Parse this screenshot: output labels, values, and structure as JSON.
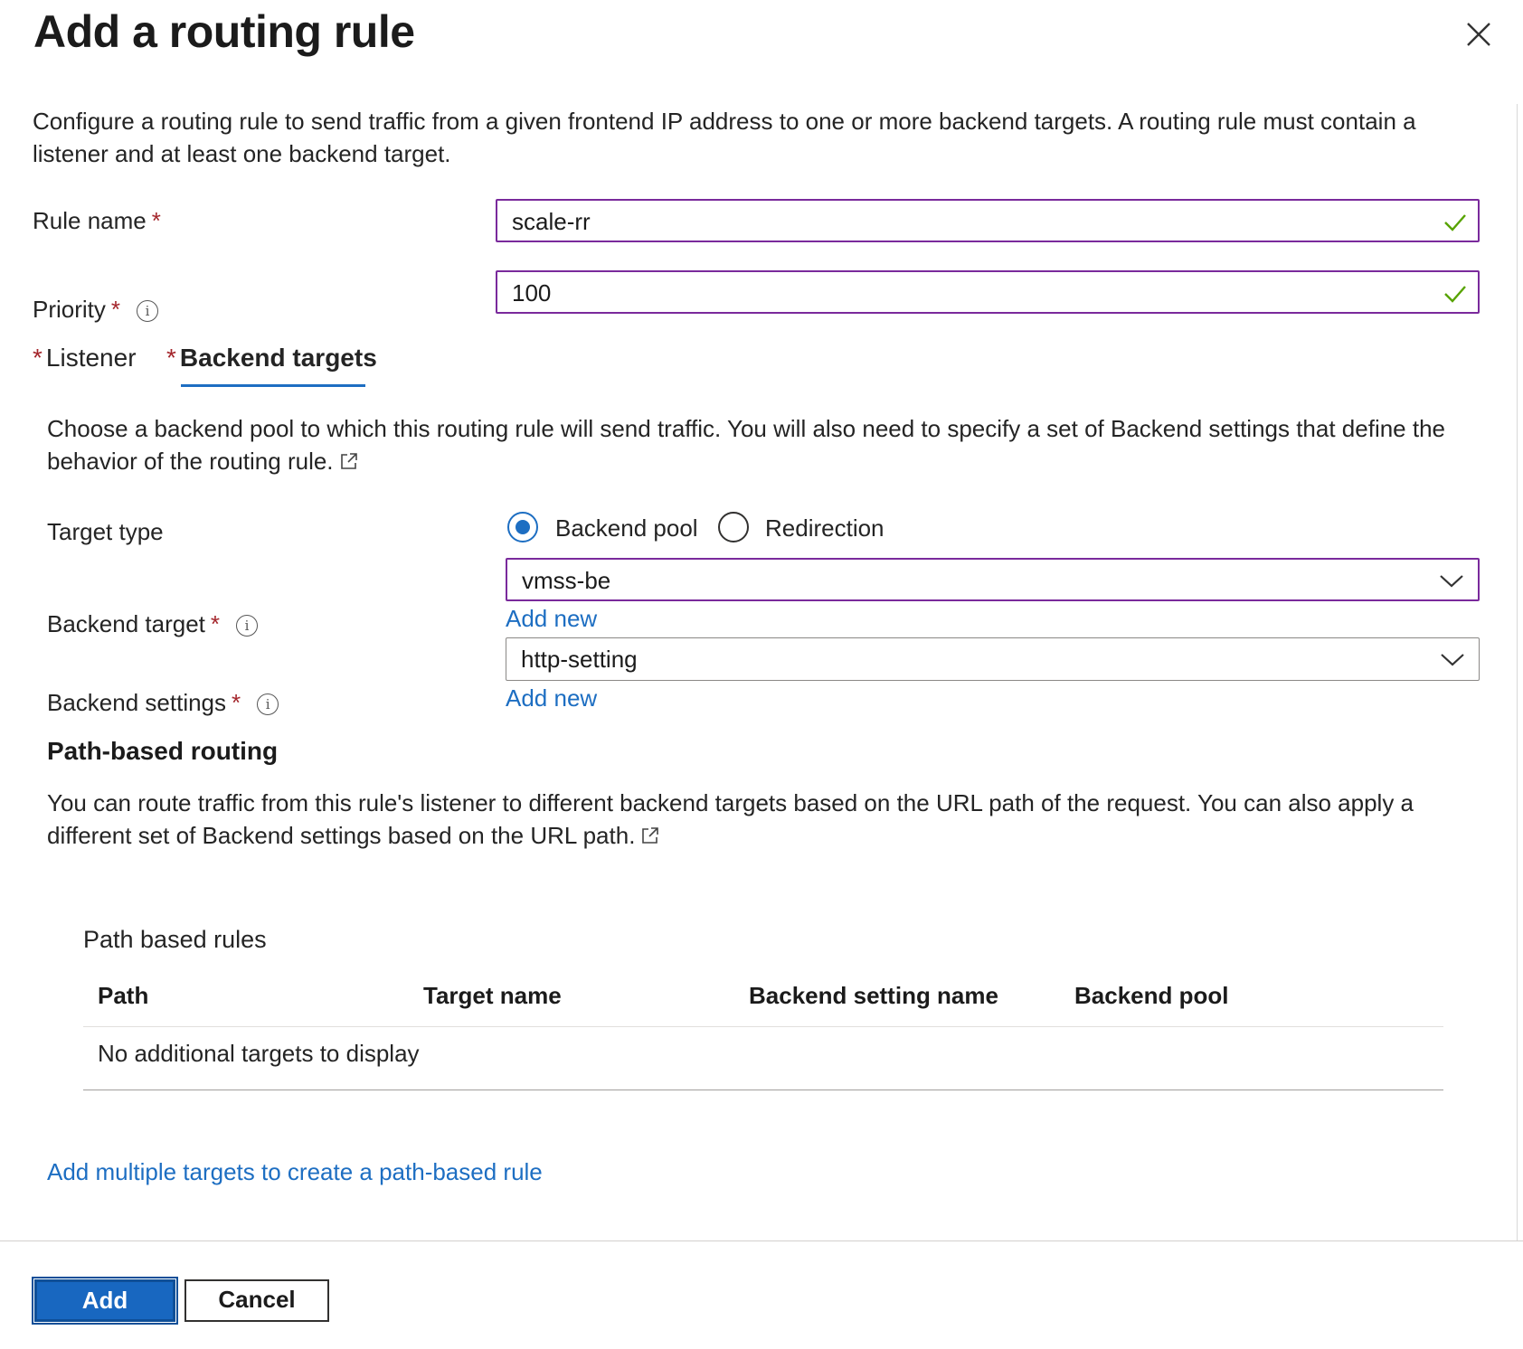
{
  "panel": {
    "title": "Add a routing rule",
    "description": "Configure a routing rule to send traffic from a given frontend IP address to one or more backend targets. A routing rule must contain a listener and at least one backend target."
  },
  "form": {
    "rule_name": {
      "label": "Rule name",
      "required": "*",
      "value": "scale-rr"
    },
    "priority": {
      "label": "Priority",
      "required": "*",
      "value": "100"
    }
  },
  "tabs": [
    {
      "label": "Listener",
      "required": "*",
      "active": false
    },
    {
      "label": "Backend targets",
      "required": "*",
      "active": true
    }
  ],
  "backend_targets": {
    "description": "Choose a backend pool to which this routing rule will send traffic. You will also need to specify a set of Backend settings that define the behavior of the routing rule.",
    "target_type": {
      "label": "Target type",
      "options": [
        "Backend pool",
        "Redirection"
      ],
      "selected": "Backend pool"
    },
    "backend_target": {
      "label": "Backend target",
      "required": "*",
      "value": "vmss-be",
      "add_new": "Add new"
    },
    "backend_settings": {
      "label": "Backend settings",
      "required": "*",
      "value": "http-setting",
      "add_new": "Add new"
    }
  },
  "path_routing": {
    "heading": "Path-based routing",
    "description": "You can route traffic from this rule's listener to different backend targets based on the URL path of the request. You can also apply a different set of Backend settings based on the URL path.",
    "table_title": "Path based rules",
    "columns": [
      "Path",
      "Target name",
      "Backend setting name",
      "Backend pool"
    ],
    "empty_message": "No additional targets to display",
    "add_link": "Add multiple targets to create a path-based rule"
  },
  "footer": {
    "add_label": "Add",
    "cancel_label": "Cancel"
  },
  "colors": {
    "accent": "#1d6ec2",
    "required": "#a4262c",
    "field_border": "#7a2a9c",
    "valid_check": "#57a300"
  },
  "icons": {
    "close": "close-icon",
    "info": "info-icon",
    "check": "checkmark-icon",
    "chevron": "chevron-down-icon",
    "external": "external-link-icon"
  }
}
